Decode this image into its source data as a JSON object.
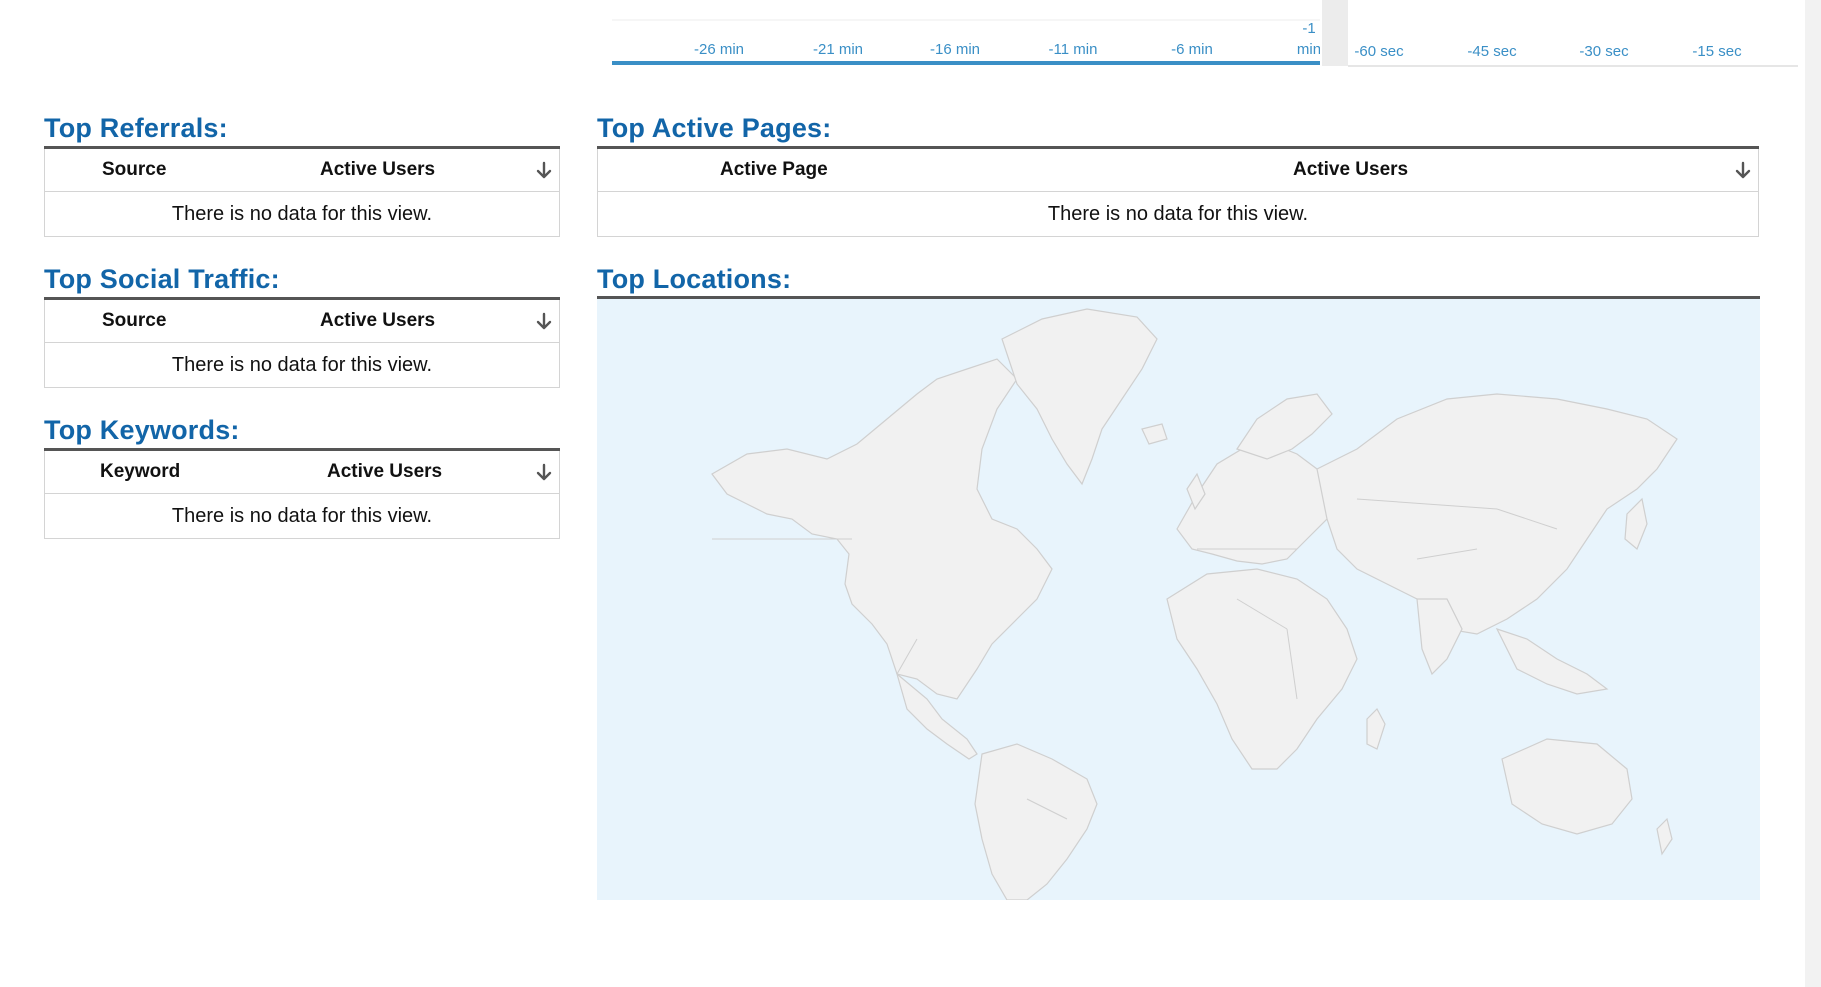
{
  "timeline": {
    "minutes_ticks": [
      "-26 min",
      "-21 min",
      "-16 min",
      "-11 min",
      "-6 min"
    ],
    "last_minute_tick": {
      "top": "-1",
      "bottom": "min"
    },
    "seconds_ticks": [
      "-60 sec",
      "-45 sec",
      "-30 sec",
      "-15 sec"
    ]
  },
  "referrals": {
    "title": "Top Referrals:",
    "col1": "Source",
    "col2": "Active Users",
    "empty": "There is no data for this view."
  },
  "social": {
    "title": "Top Social Traffic:",
    "col1": "Source",
    "col2": "Active Users",
    "empty": "There is no data for this view."
  },
  "keywords": {
    "title": "Top Keywords:",
    "col1": "Keyword",
    "col2": "Active Users",
    "empty": "There is no data for this view."
  },
  "pages": {
    "title": "Top Active Pages:",
    "col1": "Active Page",
    "col2": "Active Users",
    "empty": "There is no data for this view."
  },
  "locations": {
    "title": "Top Locations:"
  },
  "colors": {
    "heading": "#1265a8",
    "timeline_line": "#3a8fc6",
    "map_water": "#e8f4fc",
    "map_land": "#f1f1f1"
  },
  "icons": {
    "sort": "arrow-down-icon"
  }
}
